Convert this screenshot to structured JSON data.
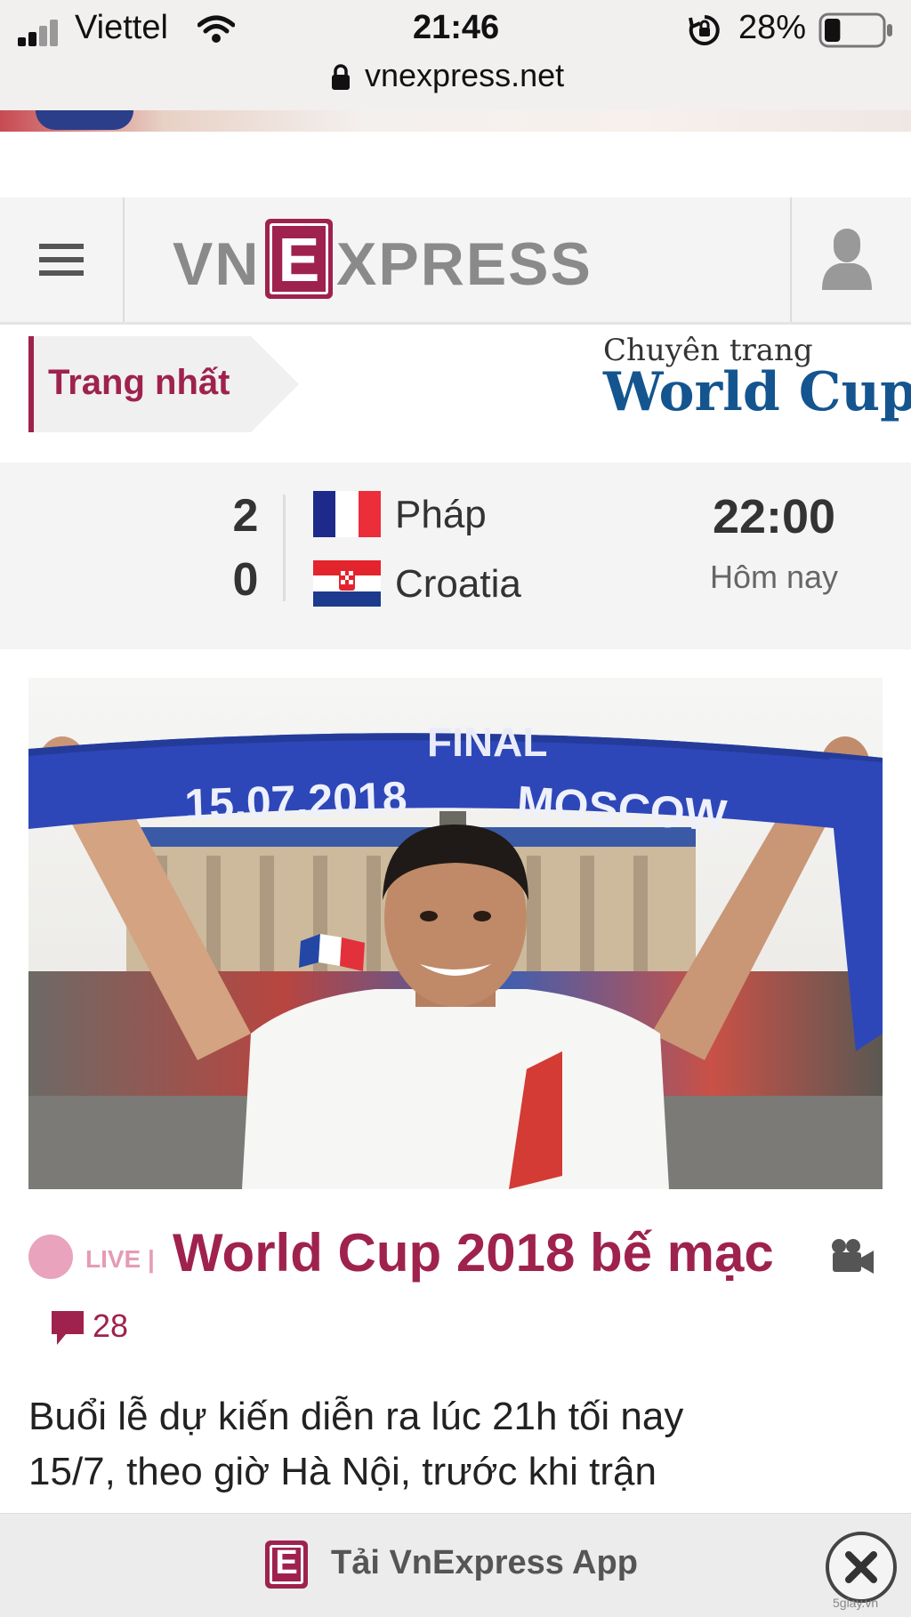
{
  "status_bar": {
    "carrier": "Viettel",
    "time": "21:46",
    "battery_percent": "28%",
    "battery_level": 0.28,
    "url": "vnexpress.net"
  },
  "header": {
    "logo_left": "VN",
    "logo_mark": "E",
    "logo_right": "XPRESS"
  },
  "breadcrumb": {
    "label": "Trang nhất"
  },
  "section": {
    "subtitle": "Chuyên trang",
    "title": "World Cup"
  },
  "match": {
    "teams": [
      {
        "score": "2",
        "name": "Pháp"
      },
      {
        "score": "0",
        "name": "Croatia"
      }
    ],
    "time": "22:00",
    "day": "Hôm nay"
  },
  "article": {
    "photo_texts": {
      "scarf_top": "FINAL",
      "scarf_date": "15.07.2018",
      "scarf_city": "MOSCOW"
    },
    "live_label": "LIVE",
    "separator": "|",
    "headline": "World Cup 2018 bế mạc",
    "comment_count": "28",
    "summary_lines": [
      "Buổi lễ dự kiến diễn ra lúc 21h tối nay",
      "15/7, theo giờ Hà Nội, trước khi trận"
    ]
  },
  "app_banner": {
    "label": "Tải VnExpress App"
  },
  "watermark": "5giay.vn",
  "colors": {
    "brand": "#9f224e",
    "world_cup_blue": "#14558f",
    "live_pink": "#e59bb6"
  }
}
